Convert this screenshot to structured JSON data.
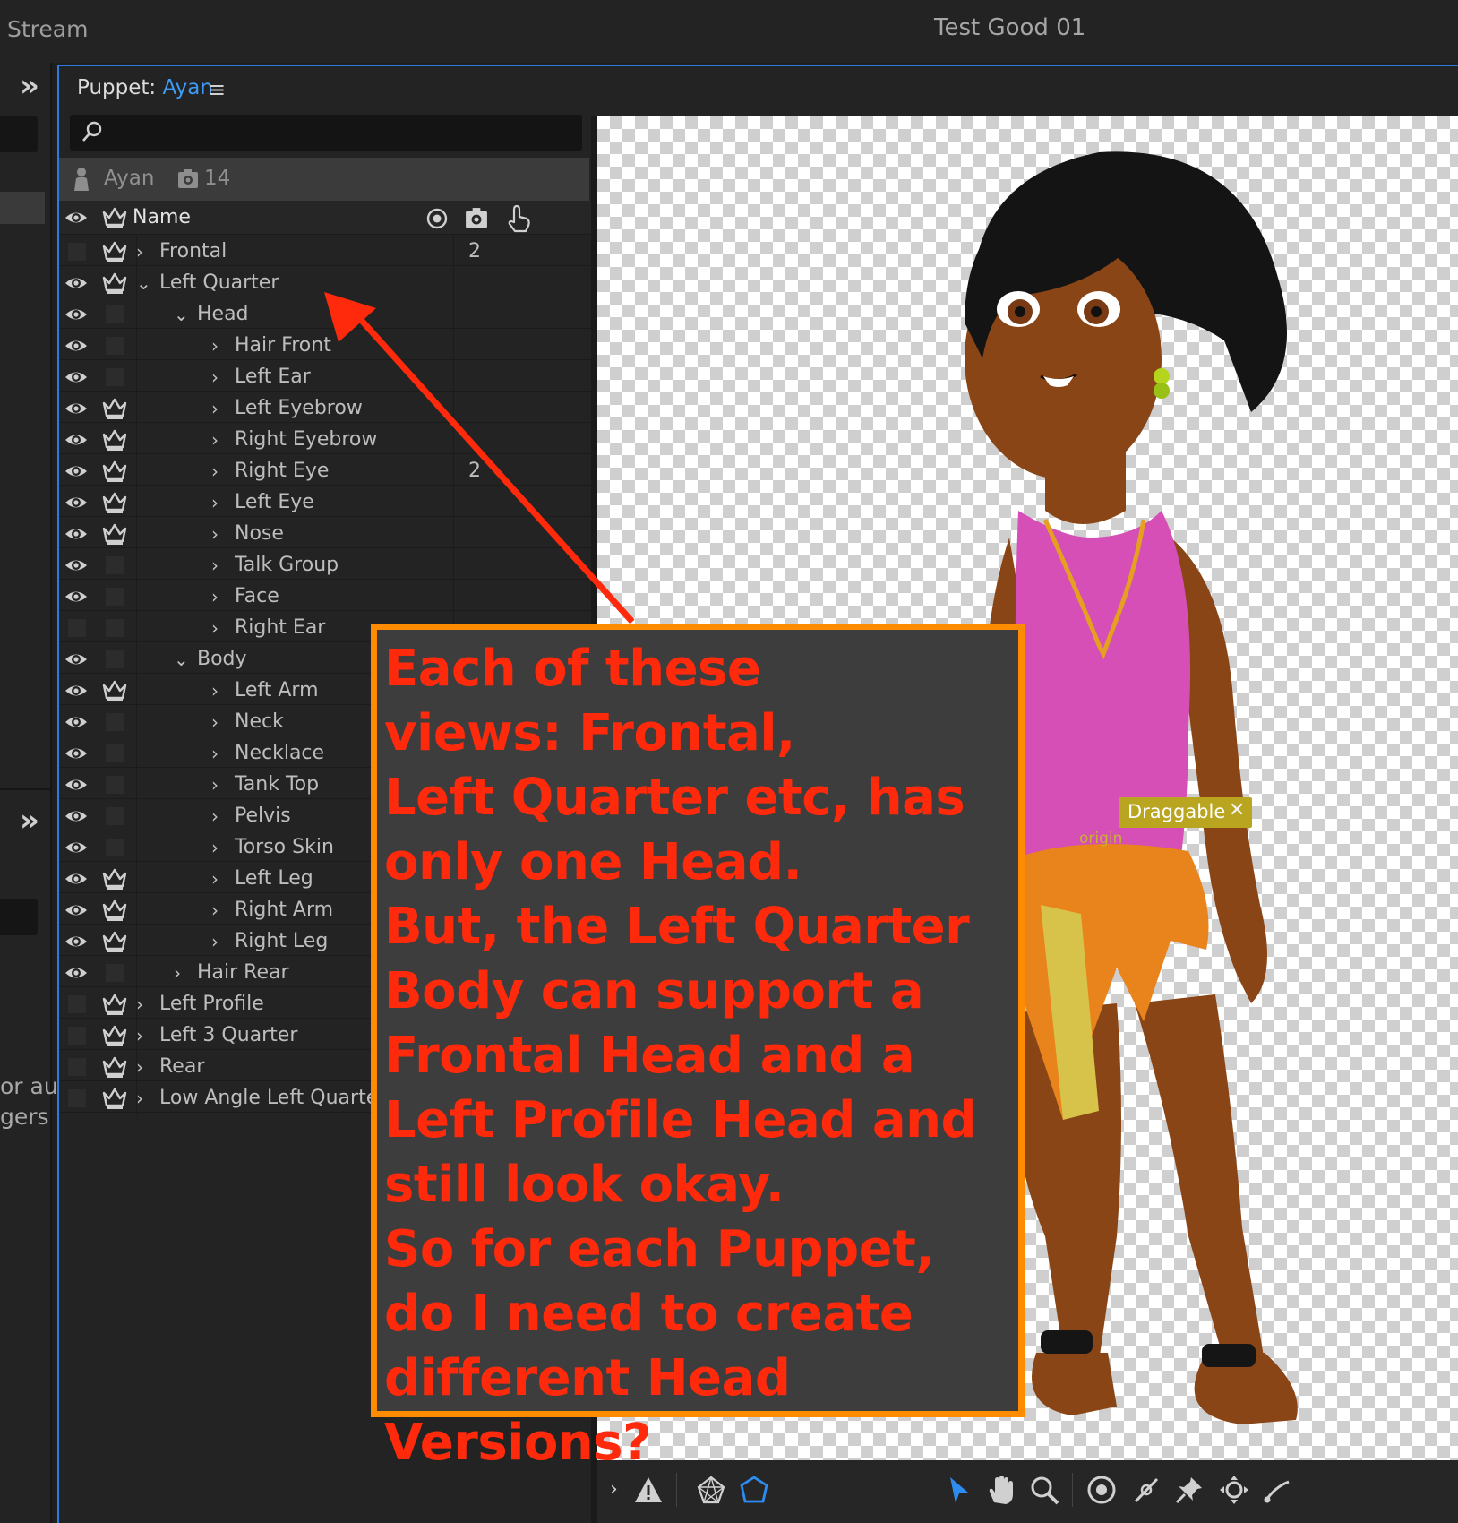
{
  "topbar": {
    "left_label": "Stream",
    "title": "Test Good 01"
  },
  "left_strip": {
    "cut_text_1": "or au",
    "cut_text_2": "gers"
  },
  "panel": {
    "title_prefix": "Puppet:",
    "puppet_name": "Ayan",
    "search_placeholder": "",
    "info_name": "Ayan",
    "info_count": "14"
  },
  "list_header": {
    "name": "Name"
  },
  "layers": [
    {
      "label": "Frontal",
      "indent": 0,
      "expanded": false,
      "eye": false,
      "crown": true,
      "count": "2"
    },
    {
      "label": "Left Quarter",
      "indent": 0,
      "expanded": true,
      "eye": true,
      "crown": true,
      "count": ""
    },
    {
      "label": "Head",
      "indent": 1,
      "expanded": true,
      "eye": true,
      "crown": false,
      "count": ""
    },
    {
      "label": "Hair Front",
      "indent": 2,
      "expanded": false,
      "eye": true,
      "crown": false,
      "count": ""
    },
    {
      "label": "Left Ear",
      "indent": 2,
      "expanded": false,
      "eye": true,
      "crown": false,
      "count": ""
    },
    {
      "label": "Left Eyebrow",
      "indent": 2,
      "expanded": false,
      "eye": true,
      "crown": true,
      "count": ""
    },
    {
      "label": "Right Eyebrow",
      "indent": 2,
      "expanded": false,
      "eye": true,
      "crown": true,
      "count": ""
    },
    {
      "label": "Right Eye",
      "indent": 2,
      "expanded": false,
      "eye": true,
      "crown": true,
      "count": "2"
    },
    {
      "label": "Left Eye",
      "indent": 2,
      "expanded": false,
      "eye": true,
      "crown": true,
      "count": ""
    },
    {
      "label": "Nose",
      "indent": 2,
      "expanded": false,
      "eye": true,
      "crown": true,
      "count": ""
    },
    {
      "label": "Talk Group",
      "indent": 2,
      "expanded": false,
      "eye": true,
      "crown": false,
      "count": ""
    },
    {
      "label": "Face",
      "indent": 2,
      "expanded": false,
      "eye": true,
      "crown": false,
      "count": ""
    },
    {
      "label": "Right Ear",
      "indent": 2,
      "expanded": false,
      "eye": false,
      "crown": false,
      "count": ""
    },
    {
      "label": "Body",
      "indent": 1,
      "expanded": true,
      "eye": true,
      "crown": false,
      "count": ""
    },
    {
      "label": "Left Arm",
      "indent": 2,
      "expanded": false,
      "eye": true,
      "crown": true,
      "count": ""
    },
    {
      "label": "Neck",
      "indent": 2,
      "expanded": false,
      "eye": true,
      "crown": false,
      "count": ""
    },
    {
      "label": "Necklace",
      "indent": 2,
      "expanded": false,
      "eye": true,
      "crown": false,
      "count": ""
    },
    {
      "label": "Tank Top",
      "indent": 2,
      "expanded": false,
      "eye": true,
      "crown": false,
      "count": ""
    },
    {
      "label": "Pelvis",
      "indent": 2,
      "expanded": false,
      "eye": true,
      "crown": false,
      "count": ""
    },
    {
      "label": "Torso Skin",
      "indent": 2,
      "expanded": false,
      "eye": true,
      "crown": false,
      "count": ""
    },
    {
      "label": "Left Leg",
      "indent": 2,
      "expanded": false,
      "eye": true,
      "crown": true,
      "count": ""
    },
    {
      "label": "Right Arm",
      "indent": 2,
      "expanded": false,
      "eye": true,
      "crown": true,
      "count": ""
    },
    {
      "label": "Right Leg",
      "indent": 2,
      "expanded": false,
      "eye": true,
      "crown": true,
      "count": ""
    },
    {
      "label": "Hair Rear",
      "indent": 1,
      "expanded": false,
      "eye": true,
      "crown": false,
      "count": ""
    },
    {
      "label": "Left Profile",
      "indent": 0,
      "expanded": false,
      "eye": false,
      "crown": true,
      "count": ""
    },
    {
      "label": "Left 3 Quarter",
      "indent": 0,
      "expanded": false,
      "eye": false,
      "crown": true,
      "count": ""
    },
    {
      "label": "Rear",
      "indent": 0,
      "expanded": false,
      "eye": false,
      "crown": true,
      "count": ""
    },
    {
      "label": "Low Angle Left Quarte",
      "indent": 0,
      "expanded": false,
      "eye": false,
      "crown": true,
      "count": ""
    }
  ],
  "canvas": {
    "tag_label": "Draggable",
    "origin_label": "origin"
  },
  "annotation": {
    "text": "Each of these\nviews: Frontal,\nLeft Quarter etc, has\nonly one Head.\nBut, the Left Quarter\nBody can support a\nFrontal Head and a\nLeft Profile Head and\nstill look okay.\nSo for each Puppet,\ndo I need to create\ndifferent Head Versions?",
    "text_color": "#ff2a0c",
    "border_color": "#ff8c00"
  },
  "toolbar_icons": [
    "chevron-right-icon",
    "warning-icon",
    "mesh-icon",
    "outline-icon",
    "select-icon",
    "hand-icon",
    "zoom-icon",
    "origin-icon",
    "stick-icon",
    "pin-icon",
    "dragger-icon",
    "bend-icon"
  ],
  "colors": {
    "accent": "#2d7be0",
    "link": "#3d9af5",
    "selected_tool": "#2d8cf0"
  }
}
